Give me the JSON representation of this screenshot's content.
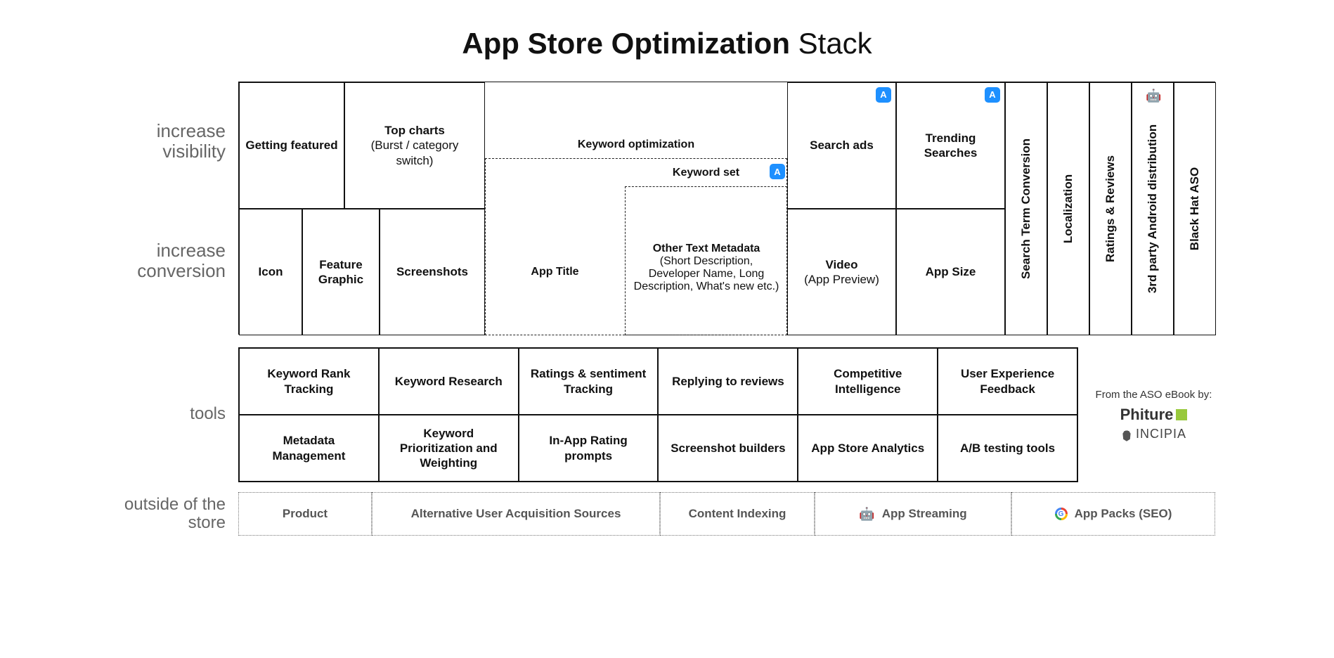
{
  "title": {
    "bold": "App Store Optimization",
    "thin": "Stack"
  },
  "labels": {
    "increase_visibility": "increase visibility",
    "increase_conversion": "increase conversion",
    "tools": "tools",
    "outside": "outside of the store"
  },
  "main": {
    "getting_featured": "Getting featured",
    "top_charts": {
      "b": "Top charts",
      "sub": "(Burst / category switch)"
    },
    "keyword_optimization": "Keyword optimization",
    "keyword_set": "Keyword set",
    "search_ads": "Search ads",
    "trending_searches": "Trending Searches",
    "icon": "Icon",
    "feature_graphic": "Feature Graphic",
    "screenshots": "Screenshots",
    "app_title": "App Title",
    "other_metadata": {
      "b": "Other Text Metadata",
      "sub": "(Short Description, Developer Name, Long Description, What's new etc.)"
    },
    "video": {
      "b": "Video",
      "sub": "(App Preview)"
    },
    "app_size": "App Size",
    "vertical": {
      "stc": "Search Term Conversion",
      "localization": "Localization",
      "ratings_reviews": "Ratings & Reviews",
      "android_dist": "3rd party Android distribution",
      "black_hat": "Black Hat ASO"
    }
  },
  "tools": [
    "Keyword Rank Tracking",
    "Keyword Research",
    "Ratings & sentiment Tracking",
    "Replying to reviews",
    "Competitive Intelligence",
    "User Experience Feedback",
    "Metadata Management",
    "Keyword Prioritization and Weighting",
    "In-App Rating prompts",
    "Screenshot builders",
    "App Store Analytics",
    "A/B testing tools"
  ],
  "credits": {
    "from": "From the ASO eBook by:",
    "phiture": "Phiture",
    "incipia": "INCIPIA"
  },
  "outside": [
    {
      "label": "Product"
    },
    {
      "label": "Alternative User Acquisition Sources"
    },
    {
      "label": "Content Indexing"
    },
    {
      "label": "App Streaming",
      "icon": "android"
    },
    {
      "label": "App Packs (SEO)",
      "icon": "google"
    }
  ]
}
